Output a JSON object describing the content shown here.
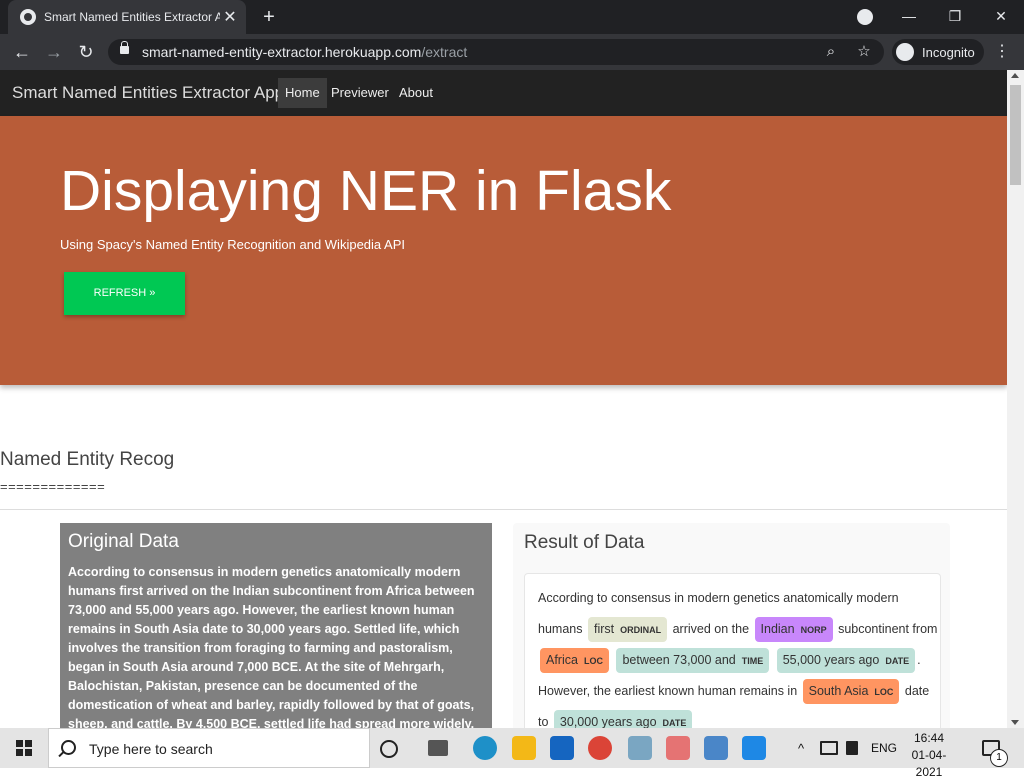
{
  "browser": {
    "tab_title": "Smart Named Entities Extractor A",
    "tab_close": "✕",
    "new_tab": "+",
    "profile_icon": "●",
    "minimize": "—",
    "restore": "❐",
    "close": "✕",
    "back": "←",
    "forward": "→",
    "reload": "↻",
    "url_host": "smart-named-entity-extractor.herokuapp.com",
    "url_path": "/extract",
    "zoom_icon": "⌕",
    "star_icon": "☆",
    "incognito_label": "Incognito",
    "menu_icon": "⋮"
  },
  "app": {
    "brand": "Smart Named Entities Extractor App",
    "nav": [
      "Home",
      "Previewer",
      "About"
    ]
  },
  "hero": {
    "title": "Displaying NER in Flask",
    "subtitle": "Using Spacy's Named Entity Recognition and Wikipedia API",
    "button": "REFRESH »",
    "color": "#b85c38",
    "button_color": "#00c853"
  },
  "section": {
    "title": "Named Entity Recog",
    "rule": "============="
  },
  "original": {
    "title": "Original Data",
    "text": "According to consensus in modern genetics anatomically modern humans first arrived on the Indian subcontinent from Africa between 73,000 and 55,000 years ago. However, the earliest known human remains in South Asia date to 30,000 years ago. Settled life, which involves the transition from foraging to farming and pastoralism, began in South Asia around 7,000 BCE. At the site of Mehrgarh, Balochistan, Pakistan, presence can be documented of the domestication of wheat and barley, rapidly followed by that of goats, sheep, and cattle. By 4,500 BCE, settled life had spread more widely, and began to gradually evolve"
  },
  "result": {
    "title": "Result of Data",
    "t1": "According to consensus in modern genetics anatomically modern humans",
    "e1_text": "first",
    "e1_label": "ORDINAL",
    "t2": "arrived on the",
    "e2_text": "Indian",
    "e2_label": "NORP",
    "t3": "subcontinent from",
    "e3_text": "Africa",
    "e3_label": "LOC",
    "e4_text": "between 73,000 and",
    "e4_label": "TIME",
    "e5_text": "55,000 years ago",
    "e5_label": "DATE",
    "t4": ". However, the earliest known human remains in",
    "e6_text": "South Asia",
    "e6_label": "LOC",
    "t5": "date to",
    "e7_text": "30,000 years ago",
    "e7_label": "DATE",
    "colors": {
      "ORDINAL": "#e4e7d2",
      "NORP": "#c887fb",
      "LOC": "#ff9561",
      "TIME": "#bfe1d9",
      "DATE": "#bfe1d9"
    }
  },
  "taskbar": {
    "search_placeholder": "Type here to search",
    "lang": "ENG",
    "time": "16:44",
    "date": "01-04-2021",
    "notifications": "1"
  }
}
